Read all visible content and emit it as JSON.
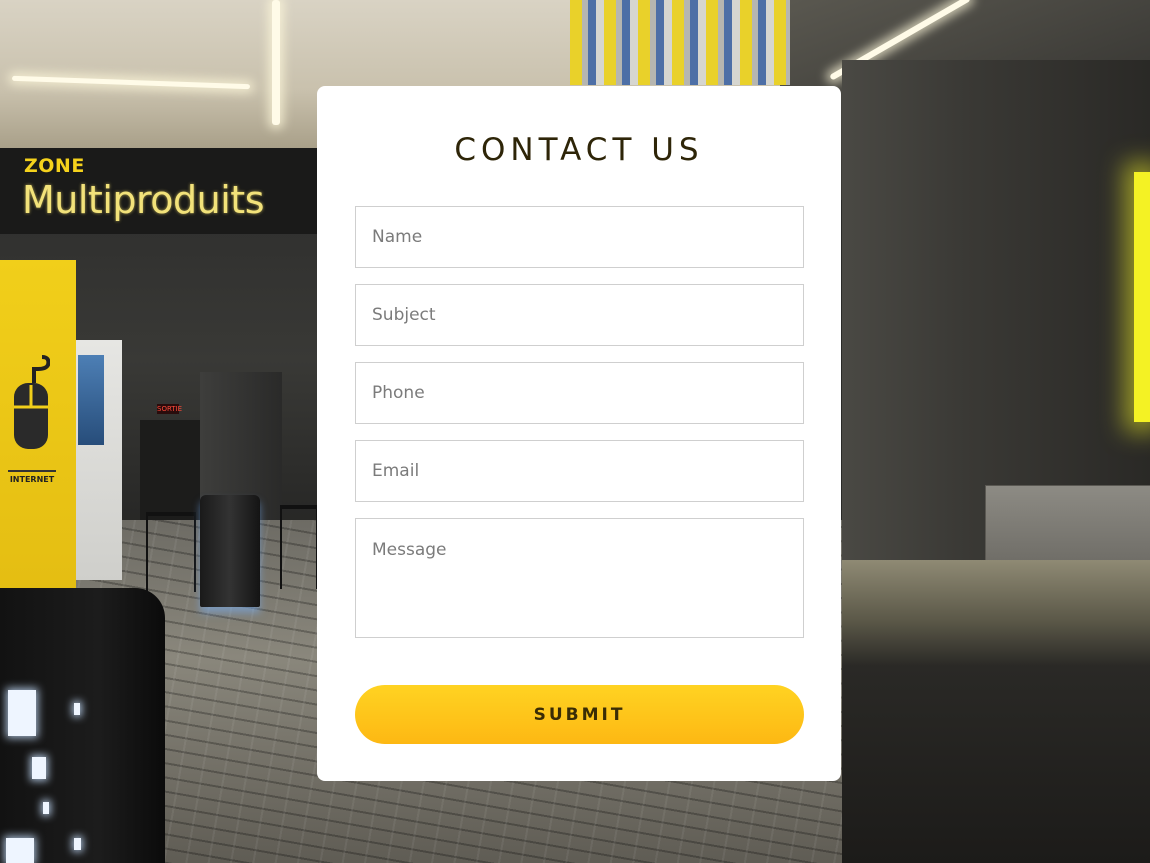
{
  "background": {
    "sign_small": "ZONE",
    "sign_big": "Multiproduits",
    "exit_sign": "SORTIE",
    "panel_label": "INTERNET",
    "icons": [
      "computer-mouse-icon"
    ],
    "colors": {
      "brand_yellow": "#f5d21c",
      "dark": "#2a2a28"
    }
  },
  "contact_form": {
    "title": "CONTACT US",
    "fields": [
      {
        "name": "name",
        "placeholder": "Name",
        "value": ""
      },
      {
        "name": "subject",
        "placeholder": "Subject",
        "value": ""
      },
      {
        "name": "phone",
        "placeholder": "Phone",
        "value": ""
      },
      {
        "name": "email",
        "placeholder": "Email",
        "value": ""
      },
      {
        "name": "message",
        "placeholder": "Message",
        "value": ""
      }
    ],
    "submit_label": "SUBMIT",
    "colors": {
      "title": "#2e2508",
      "button_top": "#ffd322",
      "button_bottom": "#fdb813",
      "button_text": "#3a2c05"
    }
  }
}
